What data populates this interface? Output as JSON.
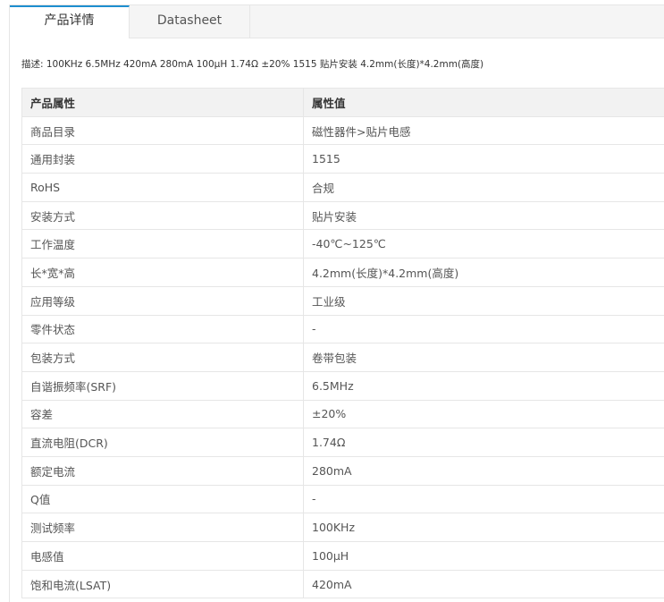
{
  "tabs": [
    {
      "label": "产品详情",
      "active": true
    },
    {
      "label": "Datasheet",
      "active": false
    }
  ],
  "description": "描述:  100KHz 6.5MHz 420mA 280mA 100μH 1.74Ω ±20% 1515 贴片安装 4.2mm(长度)*4.2mm(高度)",
  "table": {
    "headers": [
      "产品属性",
      "属性值"
    ],
    "rows": [
      {
        "attr": "商品目录",
        "value": "磁性器件>贴片电感"
      },
      {
        "attr": "通用封装",
        "value": "1515"
      },
      {
        "attr": "RoHS",
        "value": "合规"
      },
      {
        "attr": "安装方式",
        "value": "贴片安装"
      },
      {
        "attr": "工作温度",
        "value": "-40℃~125℃"
      },
      {
        "attr": "长*宽*高",
        "value": "4.2mm(长度)*4.2mm(高度)"
      },
      {
        "attr": "应用等级",
        "value": "工业级"
      },
      {
        "attr": "零件状态",
        "value": "-"
      },
      {
        "attr": "包装方式",
        "value": "卷带包装"
      },
      {
        "attr": "自谐振频率(SRF)",
        "value": "6.5MHz"
      },
      {
        "attr": "容差",
        "value": "±20%"
      },
      {
        "attr": "直流电阻(DCR)",
        "value": "1.74Ω"
      },
      {
        "attr": "额定电流",
        "value": "280mA"
      },
      {
        "attr": "Q值",
        "value": "-"
      },
      {
        "attr": "测试频率",
        "value": "100KHz"
      },
      {
        "attr": "电感值",
        "value": "100μH"
      },
      {
        "attr": "饱和电流(LSAT)",
        "value": "420mA"
      }
    ]
  },
  "colors": {
    "accent": "#1e8ecf",
    "border": "#e6e6e6",
    "header_bg": "#f2f2f2"
  }
}
